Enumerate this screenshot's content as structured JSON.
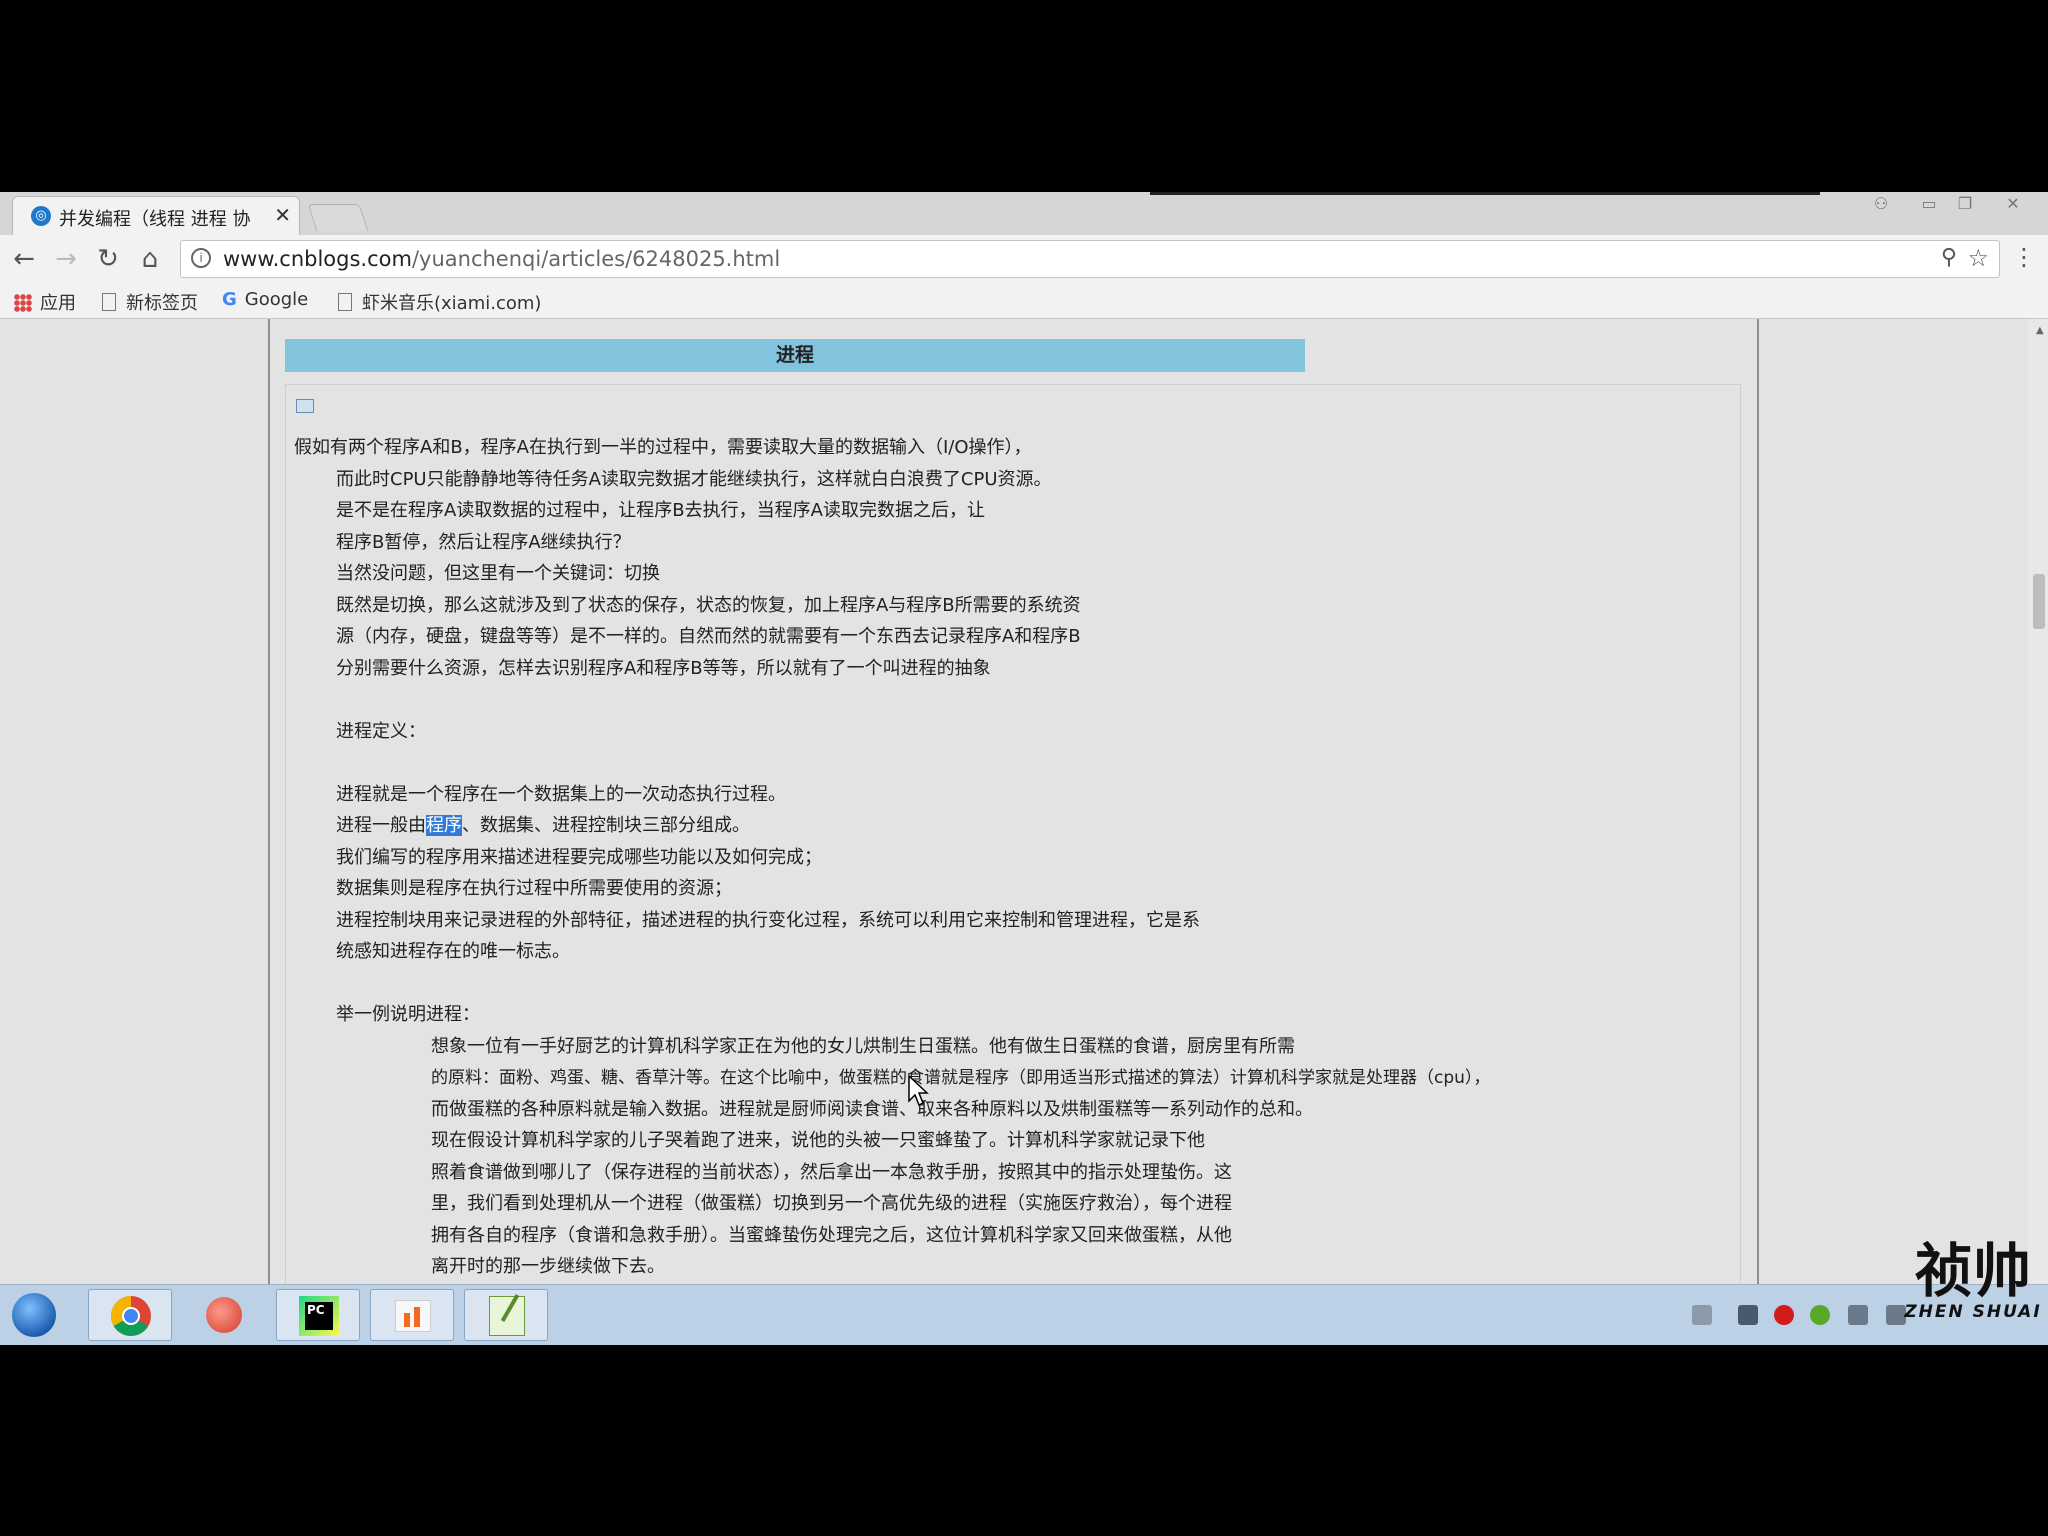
{
  "browser": {
    "tab_title": "并发编程（线程 进程 协",
    "tab_close": "✕",
    "url_host": "www.cnblogs.com",
    "url_path": "/yuanchenqi/articles/6248025.html",
    "bookmarks": [
      "应用",
      "新标签页",
      "Google",
      "虾米音乐(xiami.com)"
    ]
  },
  "article": {
    "banner": "进程",
    "paragraph1": [
      "假如有两个程序A和B，程序A在执行到一半的过程中，需要读取大量的数据输入（I/O操作），",
      "而此时CPU只能静静地等待任务A读取完数据才能继续执行，这样就白白浪费了CPU资源。",
      "是不是在程序A读取数据的过程中，让程序B去执行，当程序A读取完数据之后，让",
      "程序B暂停，然后让程序A继续执行？",
      "当然没问题，但这里有一个关键词：切换",
      "既然是切换，那么这就涉及到了状态的保存，状态的恢复，加上程序A与程序B所需要的系统资",
      "源（内存，硬盘，键盘等等）是不一样的。自然而然的就需要有一个东西去记录程序A和程序B",
      "分别需要什么资源，怎样去识别程序A和程序B等等，所以就有了一个叫进程的抽象"
    ],
    "definition_heading": "进程定义：",
    "definition_line1": "进程就是一个程序在一个数据集上的一次动态执行过程。",
    "definition_line2_pre": "进程一般由",
    "definition_line2_sel": "程序",
    "definition_line2_post": "、数据集、进程控制块三部分组成。",
    "definition_rest": [
      "我们编写的程序用来描述进程要完成哪些功能以及如何完成；",
      "数据集则是程序在执行过程中所需要使用的资源；",
      "进程控制块用来记录进程的外部特征，描述进程的执行变化过程，系统可以利用它来控制和管理进程，它是系",
      "统感知进程存在的唯一标志。"
    ],
    "example_heading": "举一例说明进程：",
    "example": [
      "想象一位有一手好厨艺的计算机科学家正在为他的女儿烘制生日蛋糕。他有做生日蛋糕的食谱，厨房里有所需",
      "的原料：面粉、鸡蛋、糖、香草汁等。在这个比喻中，做蛋糕的食谱就是程序（即用适当形式描述的算法）计算机科学家就是处理器（cpu），",
      "而做蛋糕的各种原料就是输入数据。进程就是厨师阅读食谱、取来各种原料以及烘制蛋糕等一系列动作的总和。",
      "现在假设计算机科学家的儿子哭着跑了进来，说他的头被一只蜜蜂蛰了。计算机科学家就记录下他",
      "照着食谱做到哪儿了（保存进程的当前状态），然后拿出一本急救手册，按照其中的指示处理蛰伤。这",
      "里，我们看到处理机从一个进程（做蛋糕）切换到另一个高优先级的进程（实施医疗救治），每个进程",
      "拥有各自的程序（食谱和急救手册）。当蜜蜂蛰伤处理完之后，这位计算机科学家又回来做蛋糕，从他",
      "离开时的那一步继续做下去。"
    ]
  },
  "watermark": {
    "big": "祯帅",
    "small": "ZHEN SHUAI"
  }
}
